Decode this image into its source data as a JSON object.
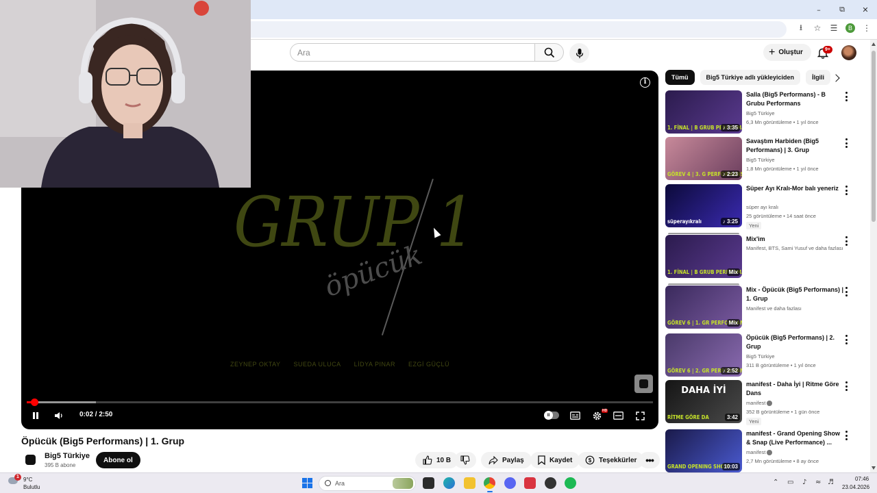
{
  "browser": {
    "window_controls": {
      "minimize": "–",
      "restore": "⧉",
      "close": "✕"
    },
    "profile_initial": "B"
  },
  "header": {
    "search_placeholder": "Ara",
    "create_label": "Oluştur",
    "notification_count": "9+"
  },
  "player": {
    "current_time": "0:02",
    "duration": "2:50",
    "time_display": "0:02 / 2:50",
    "progress_fraction": 0.012,
    "buffered_fraction": 0.11,
    "artwork": {
      "title": "GRUP 1",
      "subtitle": "öpücük",
      "names": [
        "ZEYNEP OKTAY",
        "SUEDA ULUCA",
        "LİDYA PINAR",
        "EZGİ GÜÇLÜ"
      ]
    }
  },
  "video": {
    "title": "Öpücük (Big5 Performans) | 1. Grup",
    "channel": "Big5 Türkiye",
    "subscribers": "395 B abone",
    "subscribe_label": "Abone ol",
    "likes": "10 B",
    "share_label": "Paylaş",
    "save_label": "Kaydet",
    "thanks_label": "Teşekkürler"
  },
  "sidebar": {
    "chips": [
      "Tümü",
      "Big5 Türkiye adlı yükleyiciden",
      "İlgili"
    ],
    "recommendations": [
      {
        "title": "Salla (Big5 Performans) - B Grubu Performans",
        "channel": "Big5 Türkiye",
        "meta": "6,3 Mn görüntüleme • 1 yıl önce",
        "duration": "♪ 3:35",
        "thumb_caption": "1. FİNAL | B GRUB PERFORMANS",
        "colors": [
          "#2b1b4d",
          "#5a3a8f"
        ]
      },
      {
        "title": "Savaştım Harbiden (Big5 Performans) | 3. Grup",
        "channel": "Big5 Türkiye",
        "meta": "1,8 Mn görüntüleme • 1 yıl önce",
        "duration": "♪ 2:23",
        "thumb_caption": "GÖREV 4 | 3. G PERFORMANS",
        "colors": [
          "#c88a9a",
          "#6b3e5e"
        ]
      },
      {
        "title": "Süper Ayı Kralı-Mor balı yeneriz",
        "channel": "süper ayı kralı",
        "meta": "25 görüntüleme • 14 saat önce",
        "badge": "Yeni",
        "duration": "♪ 3:25",
        "thumb_caption": "süperayıkralı",
        "colors": [
          "#0c0a3a",
          "#3a2ab0"
        ]
      },
      {
        "title": "Mix'im",
        "channel": "Manifest, BTS, Sami Yusuf ve daha fazlası",
        "duration": "Mix",
        "thumb_caption": "1. FİNAL | B GRUB PERFORMANS",
        "colors": [
          "#2b1b4d",
          "#5a3a8f"
        ]
      },
      {
        "title": "Mix - Öpücük (Big5 Performans) | 1. Grup",
        "channel": "Manifest ve daha fazlası",
        "duration": "Mix",
        "thumb_caption": "GÖREV 6 | 1. GR PERFORMANS",
        "colors": [
          "#3a2a5c",
          "#7a5aa0"
        ]
      },
      {
        "title": "Öpücük (Big5 Performans) | 2. Grup",
        "channel": "Big5 Türkiye",
        "meta": "311 B görüntüleme • 1 yıl önce",
        "duration": "♪ 2:52",
        "thumb_caption": "GÖREV 6 | 2. GR PERFORMANS",
        "colors": [
          "#4a3a6a",
          "#8a6ab0"
        ]
      },
      {
        "title": "manifest - Daha İyi | Ritme Göre Dans",
        "channel": "manifest",
        "meta": "352 B görüntüleme • 1 gün önce",
        "badge": "Yeni",
        "duration": "3:42",
        "thumb_caption": "RİTME GÖRE DA",
        "thumb_headline": "DAHA İYİ",
        "colors": [
          "#151515",
          "#4a4a4a"
        ]
      },
      {
        "title": "manifest - Grand Opening Show & Snap (Live Performance) ...",
        "channel": "manifest",
        "meta": "2,7 Mn görüntüleme • 8 ay önce",
        "duration": "10:03",
        "thumb_caption": "GRAND OPENING SHOW",
        "colors": [
          "#1a1a4a",
          "#4a5ad0"
        ]
      }
    ]
  },
  "taskbar": {
    "temperature": "9°C",
    "condition": "Bulutlu",
    "weather_alert": "1",
    "search_label": "Ara",
    "time": "07:46",
    "date": "23.04.2026"
  }
}
